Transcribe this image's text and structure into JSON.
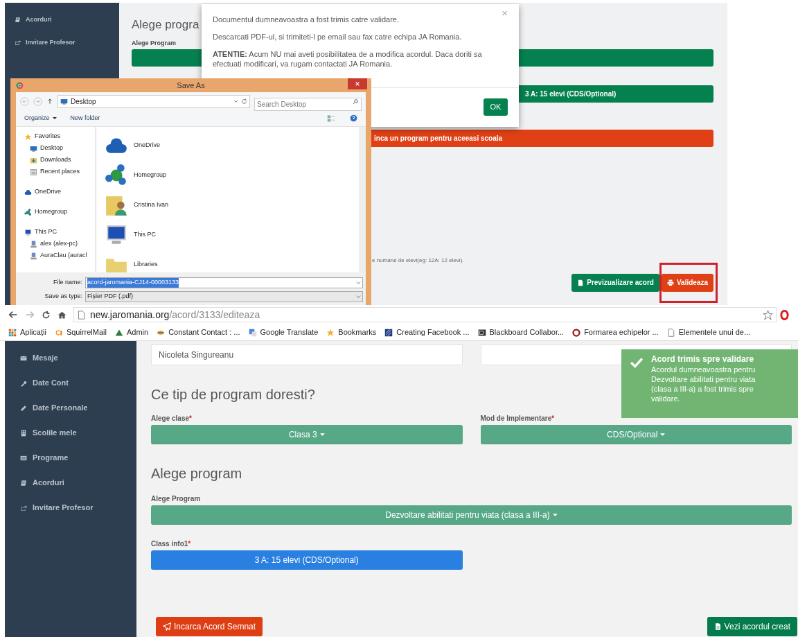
{
  "top_screenshot": {
    "sidebar": [
      {
        "kind": "book",
        "label": "Acorduri"
      },
      {
        "kind": "share",
        "label": "Invitare Profesor"
      }
    ],
    "heading": "Alege progra",
    "program_label": "Alege Program",
    "class_button": "3 A: 15 elevi (CDS/Optional)",
    "warning_bar": "inca un program pentru aceeasi scoala",
    "hint": "e numarul de elevi(eg: 12A: 12 elevi).",
    "buttons": [
      {
        "kind": "preview",
        "label": "Previzualizare acord",
        "highlighted": false
      },
      {
        "kind": "validate",
        "label": "Valideaza",
        "highlighted": true
      }
    ],
    "modal": {
      "close": "×",
      "paragraphs": [
        "Documentul dumneavoastra a fost trimis catre validare.",
        "Descarcati PDF-ul, si trimiteti-l pe email sau fax catre echipa JA Romania.",
        "**ATENTIE:** Acum NU mai aveti posibilitatea de a modifica acordul. Daca doriti sa efectuati modificari, va rugam contactati JA Romania."
      ],
      "ok": "OK"
    },
    "save_dialog": {
      "title": "Save As",
      "address": "Desktop",
      "search_placeholder": "Search Desktop",
      "toolbar": [
        {
          "kind": "menu",
          "label": "Organize"
        },
        {
          "kind": "plain",
          "label": "New folder"
        }
      ],
      "nav": [
        {
          "kind": "star",
          "label": "Favorites",
          "children": [
            {
              "kind": "monitor",
              "label": "Desktop"
            },
            {
              "kind": "download",
              "label": "Downloads"
            },
            {
              "kind": "recent",
              "label": "Recent places"
            }
          ]
        },
        {
          "kind": "cloud",
          "label": "OneDrive"
        },
        {
          "kind": "homegroup",
          "label": "Homegroup"
        },
        {
          "kind": "pc",
          "label": "This PC",
          "children": [
            {
              "kind": "drive",
              "label": "alex (alex-pc)"
            },
            {
              "kind": "drive",
              "label": "AuraClau (auracl"
            }
          ]
        }
      ],
      "items": [
        {
          "kind": "cloud",
          "label": "OneDrive"
        },
        {
          "kind": "homegroup",
          "label": "Homegroup"
        },
        {
          "kind": "user-folder",
          "label": "Cristina Ivan"
        },
        {
          "kind": "pc",
          "label": "This PC"
        },
        {
          "kind": "folder",
          "label": "Libraries"
        }
      ],
      "file_name_label": "File name:",
      "file_name": "acord-jaromania-CJ14-00003133",
      "type_label": "Save as type:",
      "type": "Fișier PDF (.pdf)"
    }
  },
  "browser": {
    "url_host": "new.jaromania.org",
    "url_path": "/acord/3133/editeaza",
    "bookmarks": [
      {
        "kind": "apps",
        "label": "Aplicații"
      },
      {
        "kind": "cp",
        "label": "SquirrelMail"
      },
      {
        "kind": "triangle",
        "label": "Admin"
      },
      {
        "kind": "swirl",
        "label": "Constant Contact : ..."
      },
      {
        "kind": "translate",
        "label": "Google Translate"
      },
      {
        "kind": "star",
        "label": "Bookmarks"
      },
      {
        "kind": "stripes",
        "label": "Creating Facebook ..."
      },
      {
        "kind": "board",
        "label": "Blackboard Collabor..."
      },
      {
        "kind": "ring",
        "label": "Formarea echipelor ..."
      },
      {
        "kind": "page",
        "label": "Elementele unui de..."
      }
    ]
  },
  "page": {
    "sidebar": [
      {
        "kind": "envelope",
        "label": "Mesaje"
      },
      {
        "kind": "wrench",
        "label": "Date Cont"
      },
      {
        "kind": "pencil",
        "label": "Date Personale"
      },
      {
        "kind": "building",
        "label": "Scolile mele"
      },
      {
        "kind": "list",
        "label": "Programe"
      },
      {
        "kind": "book",
        "label": "Acorduri"
      },
      {
        "kind": "share",
        "label": "Invitare Profesor"
      }
    ],
    "director_value": "Nicoleta Singureanu",
    "heading": "Ce tip de program doresti?",
    "class_field": {
      "label": "Alege clase",
      "required_mark": "*",
      "value": "Clasa 3"
    },
    "mode_field": {
      "label": "Mod de Implementare",
      "required_mark": "*",
      "value": "CDS/Optional"
    },
    "program_heading": "Alege program",
    "program_field": {
      "label": "Alege Program",
      "value": "Dezvoltare abilitati pentru viata (clasa a III-a)"
    },
    "class_info": {
      "label": "Class info1",
      "required_mark": "*",
      "value": "3 A: 15 elevi (CDS/Optional)"
    },
    "upload_button": "Incarca Acord Semnat",
    "view_button": "Vezi acordul creat",
    "toast": {
      "title": "Acord trimis spre validare",
      "message": "Acordul dumneavoastra pentru Dezvoltare abilitati pentru viata (clasa a III-a) a fost trimis spre validare."
    }
  }
}
